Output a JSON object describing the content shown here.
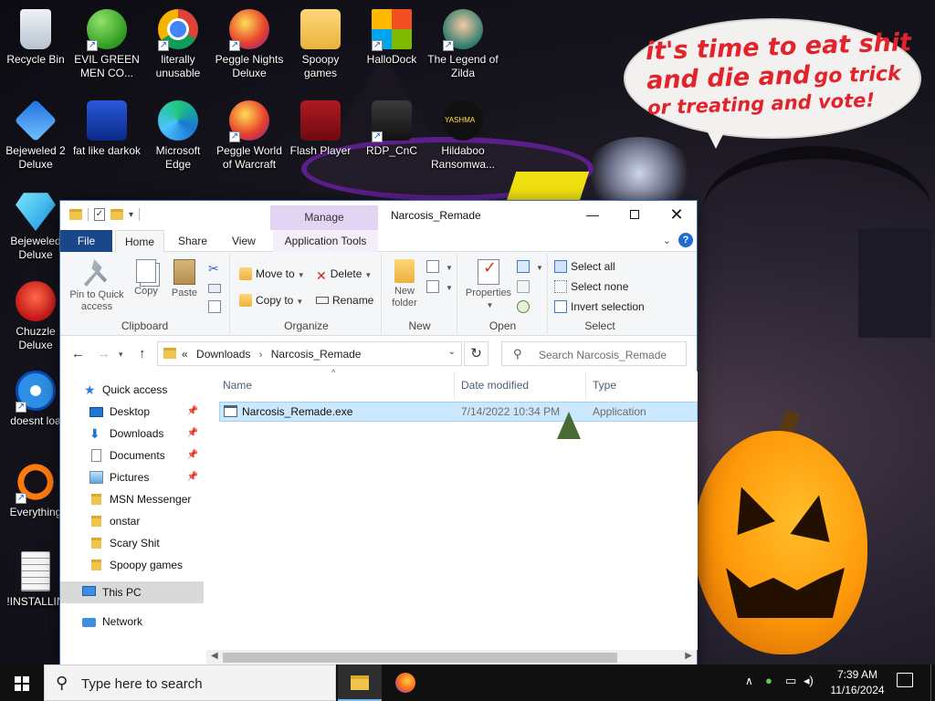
{
  "desktop": {
    "speech_bubble": {
      "line1": "it's time to eat shit",
      "line2a": "and die and",
      "line2b": "go trick",
      "line3": "or treating and vote!"
    },
    "icons": [
      {
        "label": "Recycle Bin",
        "icon": "recycle-bin-icon"
      },
      {
        "label": "EVIL GREEN MEN CO...",
        "icon": "msn-messenger-icon"
      },
      {
        "label": "literally unusable",
        "icon": "chrome-icon"
      },
      {
        "label": "Peggle Nights Deluxe",
        "icon": "peggle-icon"
      },
      {
        "label": "Spoopy games",
        "icon": "folder-icon"
      },
      {
        "label": "HalloDock",
        "icon": "windows-icon"
      },
      {
        "label": "The Legend of Zilda",
        "icon": "zelda-face-icon"
      },
      {
        "label": "Bejeweled 2 Deluxe",
        "icon": "bejeweled-icon"
      },
      {
        "label": "fat like darkok",
        "icon": "mpl-icon"
      },
      {
        "label": "Microsoft Edge",
        "icon": "edge-icon"
      },
      {
        "label": "Peggle World of Warcraft",
        "icon": "peggle-wow-icon"
      },
      {
        "label": "Flash Player",
        "icon": "flash-icon"
      },
      {
        "label": "RDP_CnC",
        "icon": "rdp-icon"
      },
      {
        "label": "Hildaboo Ransomwa...",
        "icon": "yashma-icon"
      },
      {
        "label": "Bejeweled Deluxe",
        "icon": "diamond-icon"
      },
      {
        "label": "Chuzzle Deluxe",
        "icon": "chuzzle-icon"
      },
      {
        "label": "doesnt loa",
        "icon": "thunderbird-icon"
      },
      {
        "label": "Everything",
        "icon": "everything-icon"
      },
      {
        "label": "!INSTALLIN",
        "icon": "text-document-icon"
      }
    ],
    "yashma_text": "YASHMA"
  },
  "window": {
    "title": "Narcosis_Remade",
    "manage_label": "Manage",
    "tabs": {
      "file": "File",
      "home": "Home",
      "share": "Share",
      "view": "View",
      "app_tools": "Application Tools"
    },
    "help_label": "?",
    "ribbon": {
      "clipboard": {
        "pin": "Pin to Quick access",
        "copy": "Copy",
        "paste": "Paste",
        "label": "Clipboard"
      },
      "organize": {
        "move_to": "Move to",
        "copy_to": "Copy to",
        "delete": "Delete",
        "rename": "Rename",
        "label": "Organize"
      },
      "new": {
        "new_folder": "New folder",
        "label": "New"
      },
      "open": {
        "properties": "Properties",
        "label": "Open"
      },
      "select": {
        "select_all": "Select all",
        "select_none": "Select none",
        "invert": "Invert selection",
        "label": "Select"
      }
    },
    "address": {
      "prefix": "«",
      "crumbs": [
        "Downloads",
        "Narcosis_Remade"
      ],
      "search_placeholder": "Search Narcosis_Remade"
    },
    "nav": {
      "quick_access": "Quick access",
      "items": [
        {
          "label": "Desktop",
          "pinned": true
        },
        {
          "label": "Downloads",
          "pinned": true
        },
        {
          "label": "Documents",
          "pinned": true
        },
        {
          "label": "Pictures",
          "pinned": true
        },
        {
          "label": "MSN Messenger",
          "pinned": false
        },
        {
          "label": "onstar",
          "pinned": false
        },
        {
          "label": "Scary Shit",
          "pinned": false
        },
        {
          "label": "Spoopy games",
          "pinned": false
        }
      ],
      "this_pc": "This PC",
      "network": "Network"
    },
    "columns": {
      "name": "Name",
      "date_modified": "Date modified",
      "type": "Type"
    },
    "files": [
      {
        "name": "Narcosis_Remade.exe",
        "date_modified": "7/14/2022 10:34 PM",
        "type": "Application",
        "selected": true
      }
    ]
  },
  "taskbar": {
    "search_placeholder": "Type here to search",
    "time": "7:39 AM",
    "date": "11/16/2024"
  }
}
